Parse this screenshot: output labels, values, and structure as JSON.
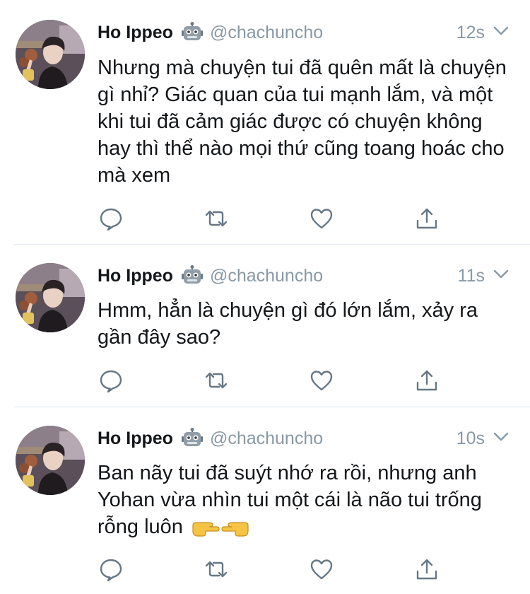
{
  "tweets": [
    {
      "name": "Ho Ippeo",
      "handle": "@chachuncho",
      "time": "12s",
      "text": "Nhưng mà chuyện tui đã quên mất là chuyện gì nhỉ? Giác quan của tui mạnh lắm, và một khi tui đã cảm giác được có chuyện không hay thì thể nào mọi thứ cũng toang hoác cho mà xem",
      "icons": [
        "reply-icon",
        "retweet-icon",
        "like-icon",
        "share-icon"
      ]
    },
    {
      "name": "Ho Ippeo",
      "handle": "@chachuncho",
      "time": "11s",
      "text": "Hmm, hẳn là chuyện gì đó lớn lắm, xảy ra gần đây sao?",
      "icons": [
        "reply-icon",
        "retweet-icon",
        "like-icon",
        "share-icon"
      ]
    },
    {
      "name": "Ho Ippeo",
      "handle": "@chachuncho",
      "time": "10s",
      "text": "Ban nãy tui đã suýt nhớ ra rồi, nhưng anh Yohan vừa nhìn tui một cái là não tui trống rỗng luôn",
      "emojis": [
        "pointing-right-emoji",
        "pointing-left-emoji"
      ],
      "icons": [
        "reply-icon",
        "retweet-icon",
        "like-icon",
        "share-icon"
      ]
    }
  ],
  "colors": {
    "text": "#14171a",
    "secondary": "#8899a6",
    "divider": "#e1e8ed",
    "icon": "#657786"
  }
}
